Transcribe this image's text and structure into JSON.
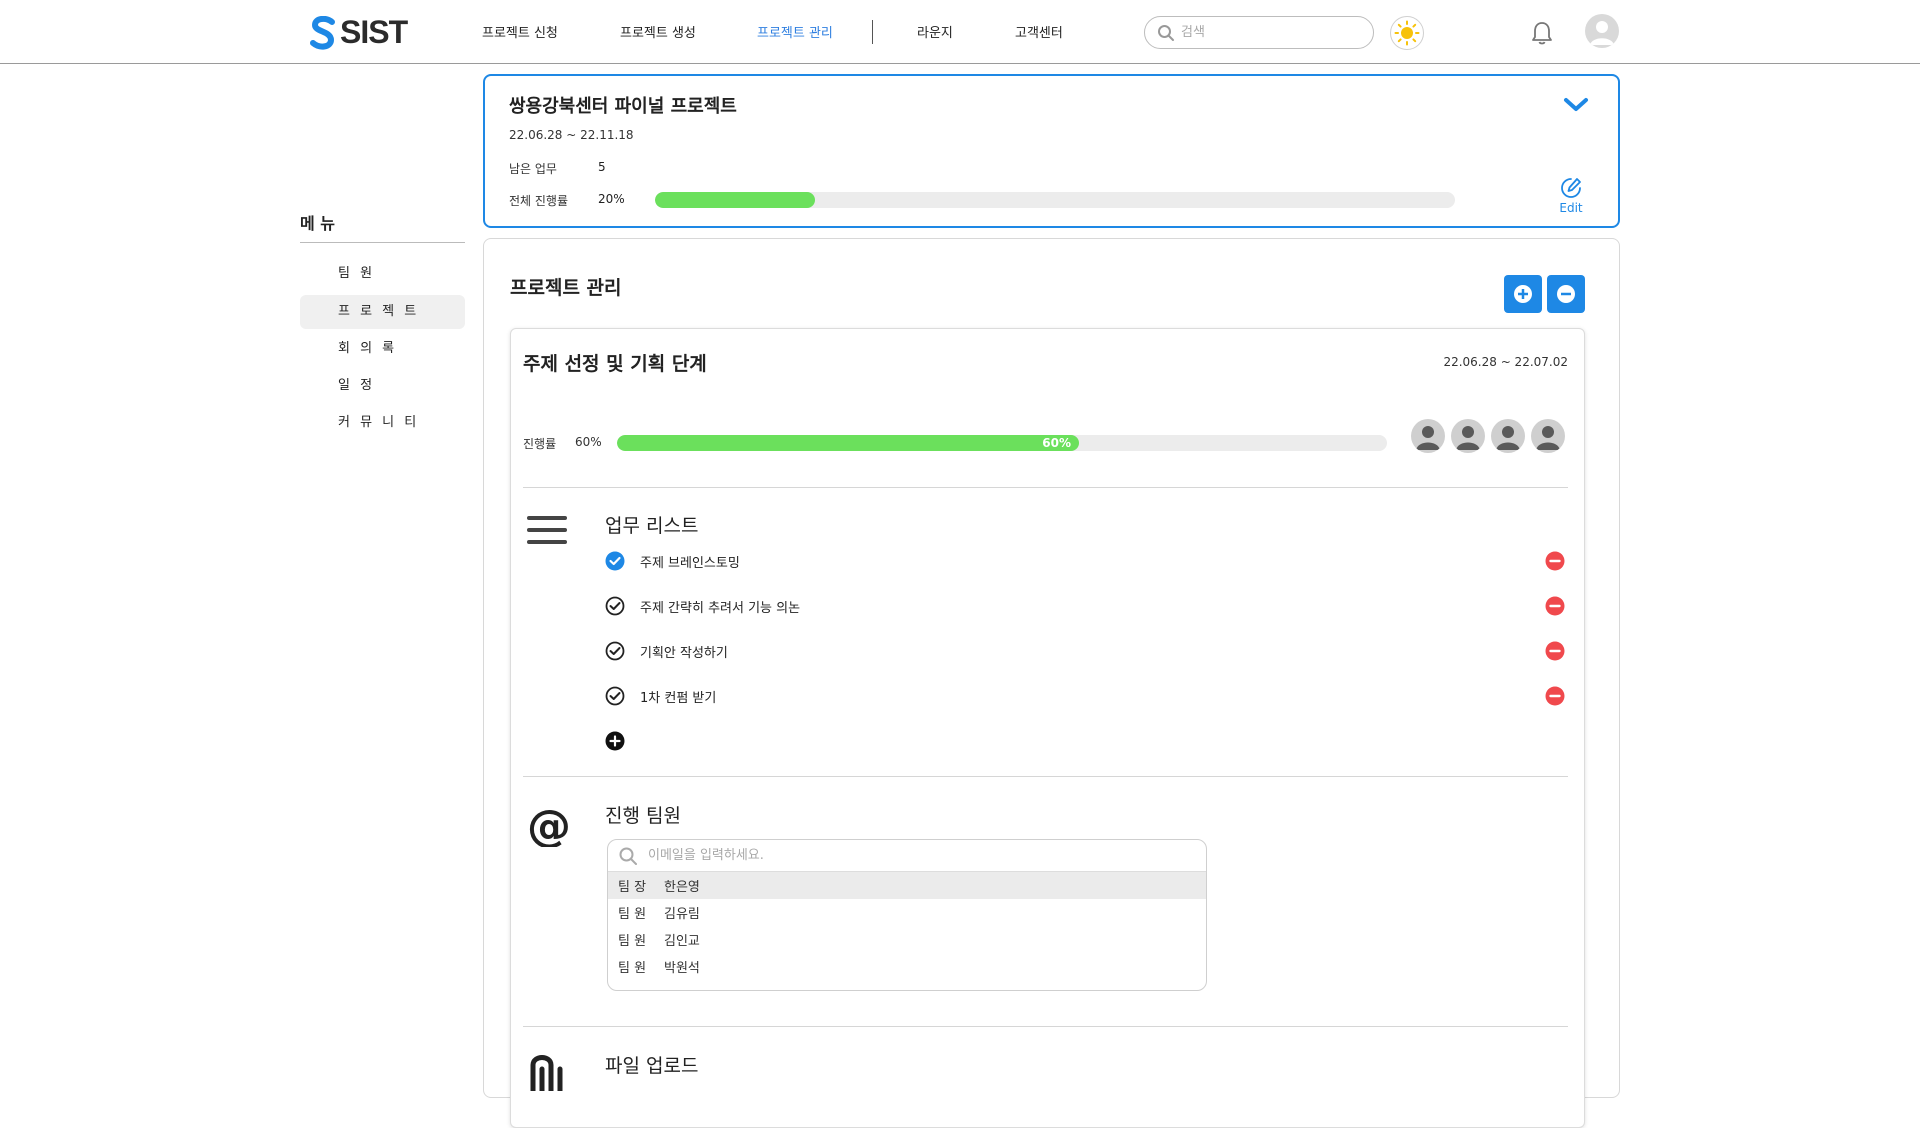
{
  "header": {
    "logo_text": "SIST",
    "nav": [
      "프로젝트 신청",
      "프로젝트 생성",
      "프로젝트 관리",
      "라운지",
      "고객센터"
    ],
    "active_nav": "프로젝트 관리",
    "search_placeholder": "검색",
    "accent": "#2f7fe0"
  },
  "sidebar": {
    "title": "메 뉴",
    "items": [
      "팀 원",
      "프 로 젝 트",
      "회 의 록",
      "일 정",
      "커 뮤 니 티"
    ],
    "active": "프 로 젝 트"
  },
  "project": {
    "title": "쌍용강북센터 파이널 프로젝트",
    "date_range": "22.06.28 ~ 22.11.18",
    "remaining_label": "남은 업무",
    "remaining_value": "5",
    "progress_label": "전체 진행률",
    "progress_value": "20%",
    "progress_fraction": 0.2,
    "edit_label": "Edit"
  },
  "management": {
    "title": "프로젝트 관리",
    "stage": {
      "title": "주제 선정 및 기획 단계",
      "date_range": "22.06.28 ~ 22.07.02",
      "progress_label": "진행률",
      "progress_value": "60%",
      "progress_fraction": 0.6,
      "progress_bar_text": "60%",
      "member_count": 4
    },
    "tasks_section": {
      "title": "업무 리스트",
      "tasks": [
        {
          "text": "주제 브레인스토밍",
          "done": true
        },
        {
          "text": "주제 간략히 추려서 기능 의논",
          "done": false
        },
        {
          "text": "기획안 작성하기",
          "done": false
        },
        {
          "text": "1차 컨펌 받기",
          "done": false
        }
      ]
    },
    "team_section": {
      "title": "진행 팀원",
      "search_placeholder": "이메일을 입력하세요.",
      "members": [
        {
          "role": "팀 장",
          "name": "한은영"
        },
        {
          "role": "팀 원",
          "name": "김유림"
        },
        {
          "role": "팀 원",
          "name": "김인교"
        },
        {
          "role": "팀 원",
          "name": "박원석"
        }
      ]
    },
    "file_section": {
      "title": "파일 업로드"
    }
  },
  "colors": {
    "primary": "#1e88e5",
    "progress": "#6be05c",
    "remove": "#f0494d"
  }
}
